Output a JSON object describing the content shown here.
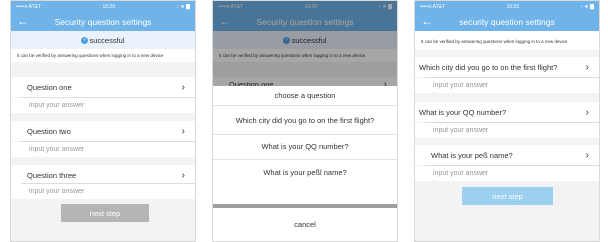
{
  "status": {
    "carrier": "•••••o AT&T",
    "wifi": "◠",
    "time": "10:20",
    "right": "↑ ★ ▇"
  },
  "nav": {
    "back": "←",
    "title1": "Security question settings",
    "title2": "Security question settings",
    "title3": "security question settings"
  },
  "success": {
    "text": "successful",
    "check": "✓"
  },
  "hint": "It can be verified by answering questions when logging in to a new device",
  "screen1": {
    "q1": "Question one",
    "q2": "Question two",
    "q3": "Question three",
    "placeholder": "input your answer",
    "next": "next step"
  },
  "screen2": {
    "q1": "Question one",
    "sheet_title": "choose a question",
    "options": [
      "Which city did you go to on the first flight?",
      "What is your QQ number?",
      "What is your peßl name?"
    ],
    "cancel": "cancel"
  },
  "screen3": {
    "q1": "Which city did you go to on the first flight?",
    "q2": "What is your QQ number?",
    "q3": "What is your peß name?",
    "placeholder": "input your answer",
    "next": "next step"
  },
  "chevron": "›"
}
